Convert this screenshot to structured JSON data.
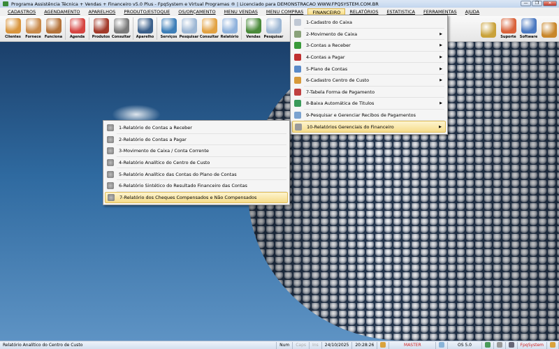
{
  "window": {
    "title": "Programa Assistência Técnica + Vendas + Financeiro v5.0 Plus - FpqSystem e Virtual Programas ® | Licenciado para  DEMONSTRACAO WWW.FPQSYSTEM.COM.BR",
    "minimize": "—",
    "maximize": "❐",
    "close": "✕"
  },
  "menubar": [
    "CADASTROS",
    "AGENDAMENTO",
    "APARELHOS",
    "PRODUTO/ESTOQUE",
    "OS/ORÇAMENTO",
    "MENU VENDAS",
    "MENU COMPRAS",
    "FINANCEIRO",
    "RELATÓRIOS",
    "ESTATISTICA",
    "FERRAMENTAS",
    "AJUDA"
  ],
  "active_menu": "FINANCEIRO",
  "toolbar": [
    {
      "label": "Clientes",
      "icon": "clients-icon",
      "color": "#d9953d"
    },
    {
      "label": "Fornece",
      "icon": "supplier-icon",
      "color": "#c98a4a"
    },
    {
      "label": "Funciona",
      "icon": "employee-icon",
      "color": "#b5733a"
    },
    {
      "sep": true
    },
    {
      "label": "Agenda",
      "icon": "calendar-icon",
      "color": "#d64541"
    },
    {
      "sep": true
    },
    {
      "label": "Produtos",
      "icon": "products-cart-icon",
      "color": "#a33a2a"
    },
    {
      "label": "Consultar",
      "icon": "barcode-icon",
      "color": "#7a7a7a"
    },
    {
      "sep": true
    },
    {
      "label": "Aparelho",
      "icon": "device-icon",
      "color": "#3a5f8a"
    },
    {
      "sep": true
    },
    {
      "label": "Serviços",
      "icon": "services-clipboard-icon",
      "color": "#3e7fb8"
    },
    {
      "label": "Pesquisar",
      "icon": "search-doc-icon",
      "color": "#9db7d4"
    },
    {
      "label": "Consultar",
      "icon": "drawer-icon",
      "color": "#e2a243"
    },
    {
      "label": "Relatório",
      "icon": "printer-icon",
      "color": "#8fb2dc"
    },
    {
      "sep": true
    },
    {
      "label": "Vendas",
      "icon": "sales-cart-icon",
      "color": "#4a8a3a"
    },
    {
      "label": "Pesquisar",
      "icon": "search-doc-icon",
      "color": "#9db7d4"
    }
  ],
  "toolbar_right": [
    {
      "label": "",
      "icon": "coin-icon",
      "color": "#c9a23a"
    },
    {
      "label": "Suporte",
      "icon": "support-icon",
      "color": "#d9623a"
    },
    {
      "label": "Software",
      "icon": "software-icon",
      "color": "#4a78c0"
    },
    {
      "label": "",
      "icon": "exit-door-icon",
      "color": "#c8862a"
    }
  ],
  "financeiro_menu": [
    {
      "label": "1-Cadastro do Caixa",
      "icon": "cashbox-icon",
      "color": "#c0c8d4",
      "sub": false
    },
    {
      "label": "2-Movimento de Caixa",
      "icon": "cash-move-icon",
      "color": "#8aa27a",
      "sub": true
    },
    {
      "label": "3-Contas a Receber",
      "icon": "receive-icon",
      "color": "#3a9a3a",
      "sub": true
    },
    {
      "label": "4-Contas a Pagar",
      "icon": "pay-icon",
      "color": "#c03030",
      "sub": true
    },
    {
      "label": "5-Plano de Contas",
      "icon": "chart-accounts-icon",
      "color": "#5a8ac8",
      "sub": true
    },
    {
      "label": "6-Cadastro Centro de Custo",
      "icon": "cost-center-icon",
      "color": "#d89a3a",
      "sub": true
    },
    {
      "label": "7-Tabela Forma de Pagamento",
      "icon": "payment-table-icon",
      "color": "#c04040",
      "sub": false
    },
    {
      "label": "8-Baixa Automática de Titulos",
      "icon": "auto-settle-icon",
      "color": "#3a9a5a",
      "sub": true
    },
    {
      "label": "9-Pesquisar e Gerenciar Recibos de Pagamentos",
      "icon": "receipt-icon",
      "color": "#7aa2d0",
      "sub": false
    },
    {
      "label": "10-Relatórios Gerenciais do Financeiro",
      "icon": "reports-icon",
      "color": "#9a9a9a",
      "sub": true,
      "highlighted": true
    }
  ],
  "relatorios_submenu": [
    {
      "label": "1-Relatório do Contas a Receber"
    },
    {
      "label": "2-Relatório do Contas a Pagar"
    },
    {
      "label": "3-Movimento de Caixa / Conta Corrente"
    },
    {
      "label": "4-Relatório Analítico do Centro de Custo"
    },
    {
      "label": "5-Relatório Analítico das Contas do Plano de Contas"
    },
    {
      "label": "6-Relatório Sintético do Resultado Financeiro das Contas"
    },
    {
      "label": "7-Relatório dos Cheques Compensados e Não Compensados",
      "highlighted": true
    }
  ],
  "statusbar": {
    "hint": "Relatório Analítico do Centro de Custo",
    "num": "Num",
    "caps": "Caps",
    "ins": "Ins",
    "date": "24/10/2025",
    "time": "20:28:26",
    "user": "MASTER",
    "os": "OS 5.0",
    "brand": "FpqSystem",
    "user_color": "#d02020"
  }
}
